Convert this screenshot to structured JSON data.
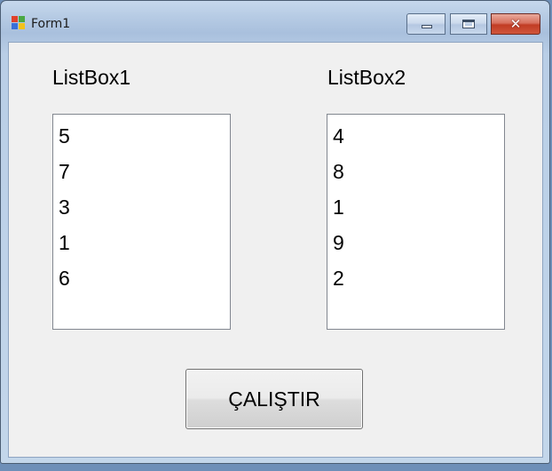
{
  "window": {
    "title": "Form1"
  },
  "labels": {
    "listbox1": "ListBox1",
    "listbox2": "ListBox2"
  },
  "listbox1": {
    "items": [
      "5",
      "7",
      "3",
      "1",
      "6"
    ]
  },
  "listbox2": {
    "items": [
      "4",
      "8",
      "1",
      "9",
      "2"
    ]
  },
  "button": {
    "run_label": "ÇALIŞTIR"
  },
  "icons": {
    "app": "form-icon",
    "minimize": "minimize-icon",
    "maximize": "maximize-icon",
    "close": "close-icon"
  },
  "colors": {
    "icon_red": "#e0412b",
    "icon_green": "#4aa843",
    "icon_blue": "#3a6fd8",
    "icon_yellow": "#f2c21b"
  }
}
